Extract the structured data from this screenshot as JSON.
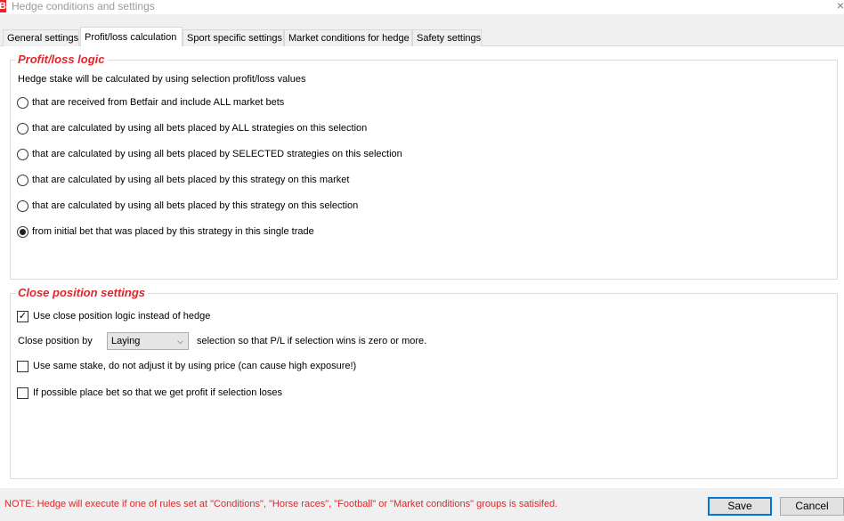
{
  "window": {
    "title": "Hedge conditions and settings",
    "app_icon_glyph": "B",
    "close_glyph": "×"
  },
  "tabs": [
    {
      "label": "General settings",
      "active": false
    },
    {
      "label": "Profit/loss calculation",
      "active": true
    },
    {
      "label": "Sport specific settings",
      "active": false
    },
    {
      "label": "Market conditions for hedge",
      "active": false
    },
    {
      "label": "Safety settings",
      "active": false
    }
  ],
  "profit_loss_logic": {
    "title": "Profit/loss logic",
    "description": "Hedge stake will be calculated by using selection profit/loss values",
    "options": [
      {
        "label": "that are received from Betfair and include ALL market bets",
        "checked": false
      },
      {
        "label": "that are calculated by using all bets placed by ALL strategies on this selection",
        "checked": false
      },
      {
        "label": "that are calculated by using all bets placed by SELECTED strategies on this selection",
        "checked": false
      },
      {
        "label": "that are calculated by using all bets placed by this strategy on this market",
        "checked": false
      },
      {
        "label": "that are calculated by using all bets placed by this strategy on this selection",
        "checked": false
      },
      {
        "label": "from initial bet that was placed by this strategy in this single trade",
        "checked": true
      }
    ]
  },
  "close_position": {
    "title": "Close position settings",
    "use_close_logic": {
      "label": "Use close position logic instead of hedge",
      "checked": true
    },
    "close_by_label": "Close position by",
    "close_by_value": "Laying",
    "close_by_suffix": "selection so that P/L if selection wins is zero or more.",
    "same_stake": {
      "label": "Use same stake, do not adjust it by using price (can cause high exposure!)",
      "checked": false
    },
    "profit_if_loses": {
      "label": "If possible place bet so that we get profit if selection loses",
      "checked": false
    }
  },
  "footer": {
    "note": "NOTE: Hedge will execute if one of rules set at \"Conditions\", \"Horse races\", \"Football\" or \"Market conditions\" groups is satisifed.",
    "save_label": "Save",
    "cancel_label": "Cancel"
  },
  "colors": {
    "accent_red": "#e0262a",
    "default_button_border": "#0078d7"
  },
  "icons": {
    "check": "✓",
    "dropdown": "chevron-down-icon"
  }
}
